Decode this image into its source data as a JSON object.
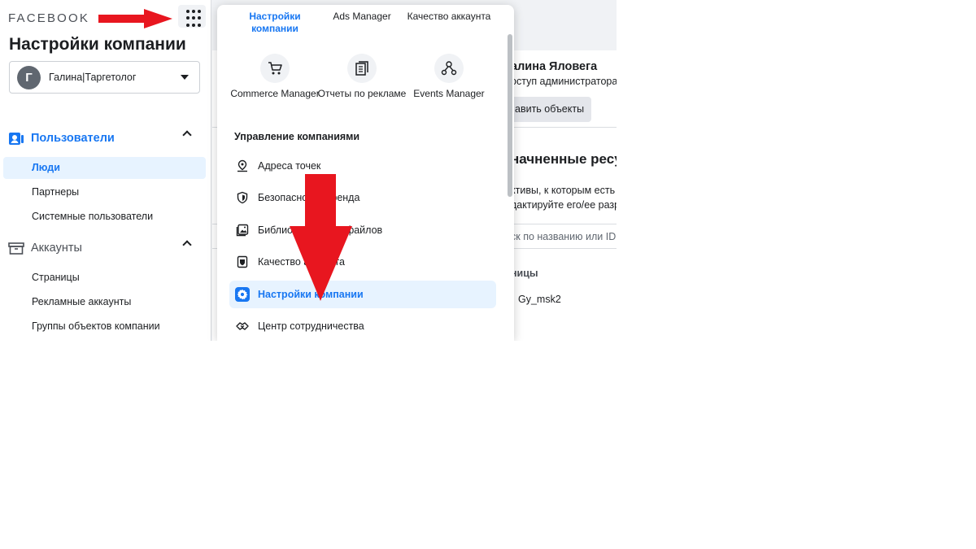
{
  "sidebar": {
    "brand": "FACEBOOK",
    "page_title": "Настройки компании",
    "account": {
      "avatar_letter": "Г",
      "name": "Галина|Таргетолог"
    },
    "users_section": {
      "label": "Пользователи",
      "items": [
        {
          "label": "Люди",
          "active": true
        },
        {
          "label": "Партнеры"
        },
        {
          "label": "Системные пользователи"
        }
      ]
    },
    "accounts_section": {
      "label": "Аккаунты",
      "items": [
        {
          "label": "Страницы"
        },
        {
          "label": "Рекламные аккаунты"
        },
        {
          "label": "Группы объектов компании"
        }
      ]
    }
  },
  "main": {
    "person_name": "алина Яловега",
    "access": "оступ администратора",
    "add_button": "авить объекты",
    "heading": "начненные ресурс",
    "desc_line1": "ктивы, к которым есть",
    "desc_line2": "дактируйте его/ее разр",
    "search_placeholder": "ск по названию или ID",
    "pages_label": "ницы",
    "page_item": "Gy_msk2"
  },
  "menu": {
    "top_tiles": [
      {
        "label": "Настройки компании",
        "active": true
      },
      {
        "label": "Ads Manager"
      },
      {
        "label": "Качество аккаунта"
      }
    ],
    "tiles": [
      {
        "label": "Commerce Manager",
        "icon": "cart-icon"
      },
      {
        "label": "Отчеты по рекламе",
        "icon": "reports-icon"
      },
      {
        "label": "Events Manager",
        "icon": "events-icon"
      }
    ],
    "management_title": "Управление компаниями",
    "items": [
      {
        "label": "Адреса точек",
        "icon": "location-pin-icon"
      },
      {
        "label": "Безопасность бренда",
        "icon": "shield-icon"
      },
      {
        "label": "Библиотека медиафайлов",
        "icon": "media-library-icon"
      },
      {
        "label": "Качество аккаунта",
        "icon": "account-quality-icon"
      },
      {
        "label": "Настройки компании",
        "icon": "gear-icon",
        "active": true
      },
      {
        "label": "Центр сотрудничества",
        "icon": "handshake-icon"
      }
    ]
  },
  "colors": {
    "accent": "#1877f2",
    "active_bg": "#e7f3ff",
    "annotation": "#e8161f"
  }
}
